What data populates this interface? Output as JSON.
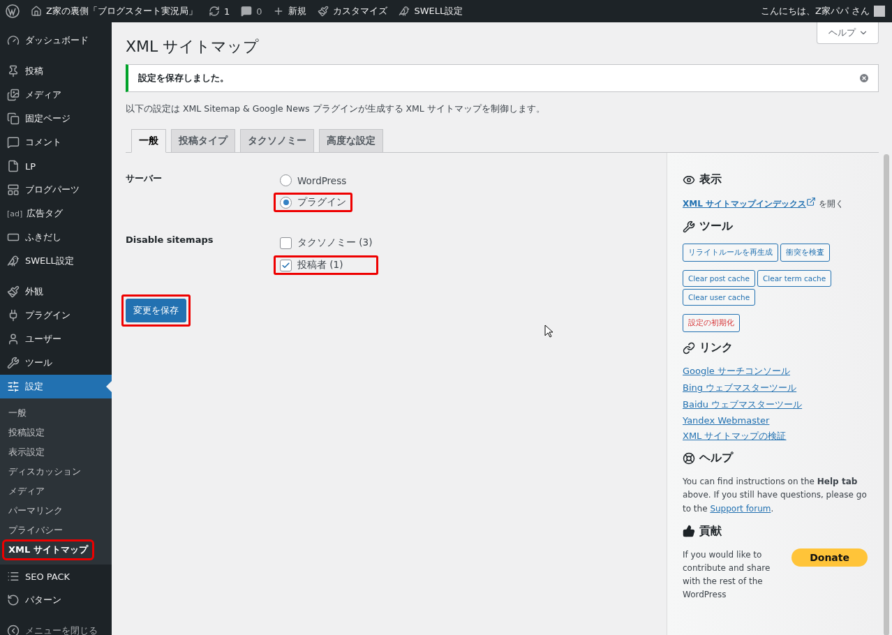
{
  "admin_bar": {
    "site_name": "Z家の裏側「ブログスタート実況局」",
    "updates": "1",
    "comments": "0",
    "new": "新規",
    "customize": "カスタマイズ",
    "swell": "SWELL設定",
    "greeting": "こんにちは、Z家パパ さん"
  },
  "sidebar": {
    "menu_groups": [
      [
        {
          "label": "ダッシュボード",
          "selected": false
        }
      ],
      [
        {
          "label": "投稿",
          "selected": false
        },
        {
          "label": "メディア",
          "selected": false
        },
        {
          "label": "固定ページ",
          "selected": false
        },
        {
          "label": "コメント",
          "selected": false
        },
        {
          "label": "LP",
          "selected": false
        },
        {
          "label": "ブログパーツ",
          "selected": false
        },
        {
          "label": "広告タグ",
          "selected": false,
          "badge": "[ad]"
        },
        {
          "label": "ふきだし",
          "selected": false
        },
        {
          "label": "SWELL設定",
          "selected": false
        }
      ],
      [
        {
          "label": "外観",
          "selected": false
        },
        {
          "label": "プラグイン",
          "selected": false
        },
        {
          "label": "ユーザー",
          "selected": false
        },
        {
          "label": "ツール",
          "selected": false
        },
        {
          "label": "設定",
          "selected": true,
          "children": [
            {
              "label": "一般",
              "selected": false,
              "highlighted": false
            },
            {
              "label": "投稿設定",
              "selected": false,
              "highlighted": false
            },
            {
              "label": "表示設定",
              "selected": false,
              "highlighted": false
            },
            {
              "label": "ディスカッション",
              "selected": false,
              "highlighted": false
            },
            {
              "label": "メディア",
              "selected": false,
              "highlighted": false
            },
            {
              "label": "パーマリンク",
              "selected": false,
              "highlighted": false
            },
            {
              "label": "プライバシー",
              "selected": false,
              "highlighted": false
            },
            {
              "label": "XML サイトマップ",
              "selected": true,
              "highlighted": true
            }
          ]
        },
        {
          "label": "SEO PACK",
          "selected": false
        },
        {
          "label": "パターン",
          "selected": false
        }
      ]
    ],
    "collapse": "メニューを閉じる"
  },
  "help_tab": "ヘルプ",
  "title": "XML サイトマップ",
  "notice": "設定を保存しました。",
  "description": "以下の設定は XML Sitemap & Google News プラグインが生成する XML サイトマップを制御します。",
  "tabs": [
    {
      "label": "一般",
      "selected": true
    },
    {
      "label": "投稿タイプ",
      "selected": false
    },
    {
      "label": "タクソノミー",
      "selected": false
    },
    {
      "label": "高度な設定",
      "selected": false
    }
  ],
  "form": {
    "rows": [
      {
        "label": "サーバー",
        "kind": "radio",
        "options": [
          {
            "label": "WordPress",
            "checked": false,
            "highlighted": false
          },
          {
            "label": "プラグイン",
            "checked": true,
            "highlighted": true
          }
        ]
      },
      {
        "label": "Disable sitemaps",
        "kind": "checkbox",
        "options": [
          {
            "label": "タクソノミー (3)",
            "checked": false,
            "highlighted": false
          },
          {
            "label": "投稿者 (1)",
            "checked": true,
            "highlighted": true
          }
        ]
      }
    ],
    "save_button": {
      "label": "変更を保存",
      "highlighted": true
    }
  },
  "aside": {
    "view": {
      "heading": "表示",
      "link": "XML サイトマップインデックス",
      "suffix": "を開く"
    },
    "tools": {
      "heading": "ツール",
      "button_rows": [
        [
          {
            "label": "リライトルールを再生成",
            "kind": "normal"
          },
          {
            "label": "衝突を検査",
            "kind": "normal"
          }
        ],
        [
          {
            "label": "Clear post cache",
            "kind": "normal"
          },
          {
            "label": "Clear term cache",
            "kind": "normal"
          },
          {
            "label": "Clear user cache",
            "kind": "normal"
          }
        ],
        [
          {
            "label": "設定の初期化",
            "kind": "danger"
          }
        ]
      ]
    },
    "links": {
      "heading": "リンク",
      "items": [
        "Google サーチコンソール",
        "Bing ウェブマスターツール",
        "Baidu ウェブマスターツール",
        "Yandex Webmaster",
        "XML サイトマップの検証"
      ]
    },
    "help": {
      "heading": "ヘルプ",
      "text": "You can find instructions on the **Help tab** above. If you still have questions, please go to the ",
      "link": "Support forum",
      "after": "."
    },
    "contribute": {
      "heading": "貢献",
      "text": "If you would like to contribute and share with the rest of the WordPress",
      "donate": "Donate"
    }
  }
}
